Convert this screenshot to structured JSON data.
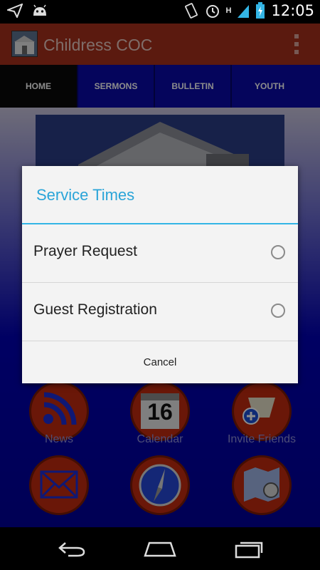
{
  "status_bar": {
    "time": "12:05",
    "network_type": "H",
    "left_icons": [
      "send-icon",
      "android-icon"
    ],
    "right_icons": [
      "vibrate-icon",
      "alarm-icon",
      "signal-icon",
      "battery-charging-icon"
    ]
  },
  "action_bar": {
    "title": "Childress COC",
    "color": "#a6311c"
  },
  "tabs": [
    {
      "label": "HOME",
      "selected": true
    },
    {
      "label": "SERMONS",
      "selected": false
    },
    {
      "label": "BULLETIN",
      "selected": false
    },
    {
      "label": "YOUTH",
      "selected": false
    }
  ],
  "grid": [
    {
      "label": "News",
      "icon": "rss-icon"
    },
    {
      "label": "Calendar",
      "icon": "calendar-icon",
      "date": "16"
    },
    {
      "label": "Invite Friends",
      "icon": "invite-icon"
    },
    {
      "label": "",
      "icon": "mail-icon"
    },
    {
      "label": "",
      "icon": "compass-icon"
    },
    {
      "label": "",
      "icon": "map-icon"
    }
  ],
  "dialog": {
    "title": "Service Times",
    "options": [
      {
        "label": "Prayer Request",
        "selected": false
      },
      {
        "label": "Guest Registration",
        "selected": false
      }
    ],
    "cancel_label": "Cancel",
    "accent_color": "#33b5e5"
  },
  "nav_bar": {
    "buttons": [
      "back-icon",
      "home-icon",
      "recents-icon"
    ]
  }
}
